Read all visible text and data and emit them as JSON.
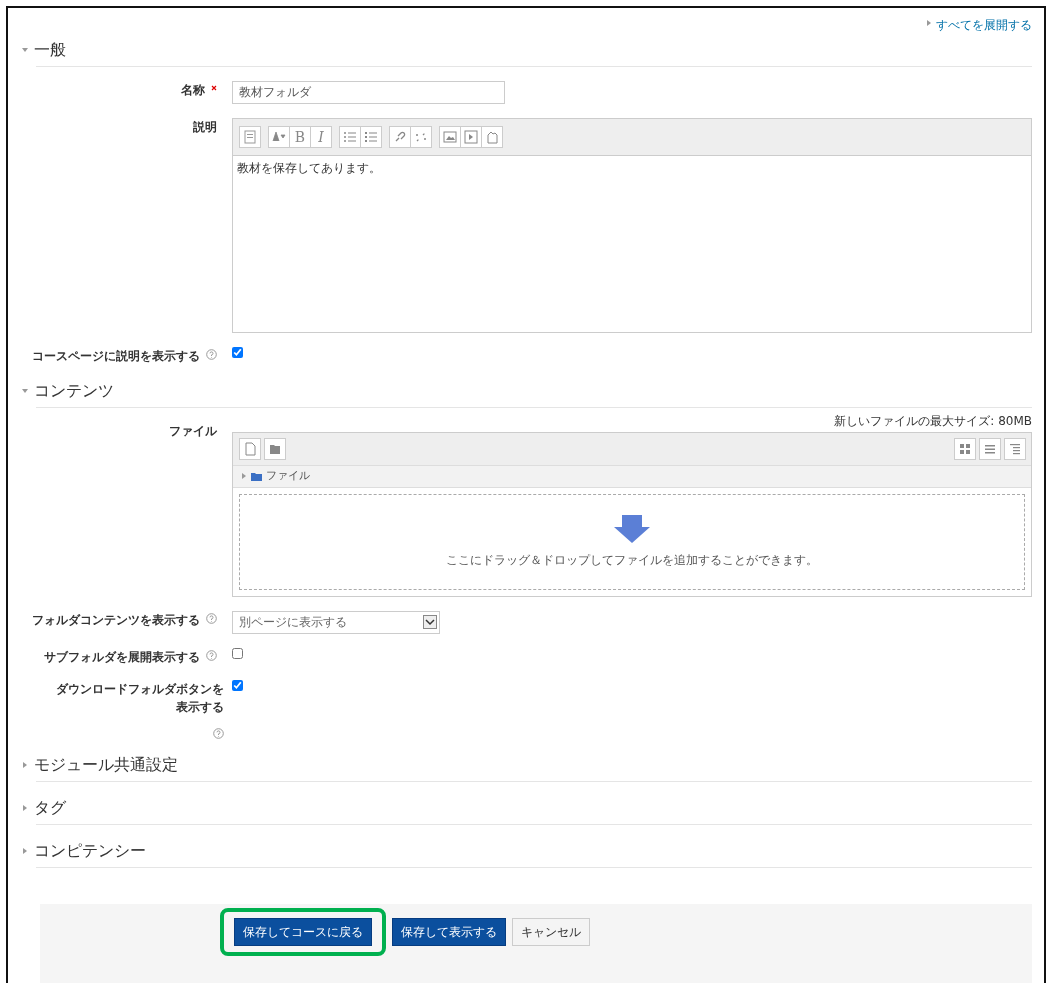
{
  "expand_all_link": "すべてを展開する",
  "sections": [
    {
      "title": "一般",
      "expanded": true,
      "fields": [
        {
          "kind": "text",
          "label": "名称",
          "required": true,
          "value": "教材フォルダ"
        },
        {
          "kind": "editor",
          "label": "説明",
          "glyph_buttons": [
            {
              "label": "B",
              "italic": false
            },
            {
              "label": "I",
              "italic": true
            }
          ],
          "value": "教材を保存してあります。"
        },
        {
          "kind": "checkbox",
          "label": "コースページに説明を表示する",
          "help": true,
          "checked": true
        }
      ]
    },
    {
      "title": "コンテンツ",
      "expanded": true,
      "fields": [
        {
          "kind": "files",
          "label": "ファイル",
          "max_size": "新しいファイルの最大サイズ: 80MB",
          "path": "ファイル",
          "drop_hint": "ここにドラッグ＆ドロップしてファイルを追加することができます。"
        },
        {
          "kind": "select",
          "label": "フォルダコンテンツを表示する",
          "help": true,
          "value": "別ページに表示する"
        },
        {
          "kind": "checkbox",
          "label": "サブフォルダを展開表示する",
          "help": true,
          "checked": false
        },
        {
          "kind": "checkbox",
          "label": "ダウンロードフォルダボタンを表示する",
          "help": true,
          "help_below": true,
          "checked": true
        }
      ]
    },
    {
      "title": "モジュール共通設定",
      "expanded": false
    },
    {
      "title": "タグ",
      "expanded": false
    },
    {
      "title": "コンピテンシー",
      "expanded": false
    }
  ],
  "buttons": [
    {
      "label": "保存してコースに戻る",
      "kind": "primary",
      "highlighted": true
    },
    {
      "label": "保存して表示する",
      "kind": "primary",
      "highlighted": false
    },
    {
      "label": "キャンセル",
      "kind": "secondary",
      "highlighted": false
    }
  ]
}
